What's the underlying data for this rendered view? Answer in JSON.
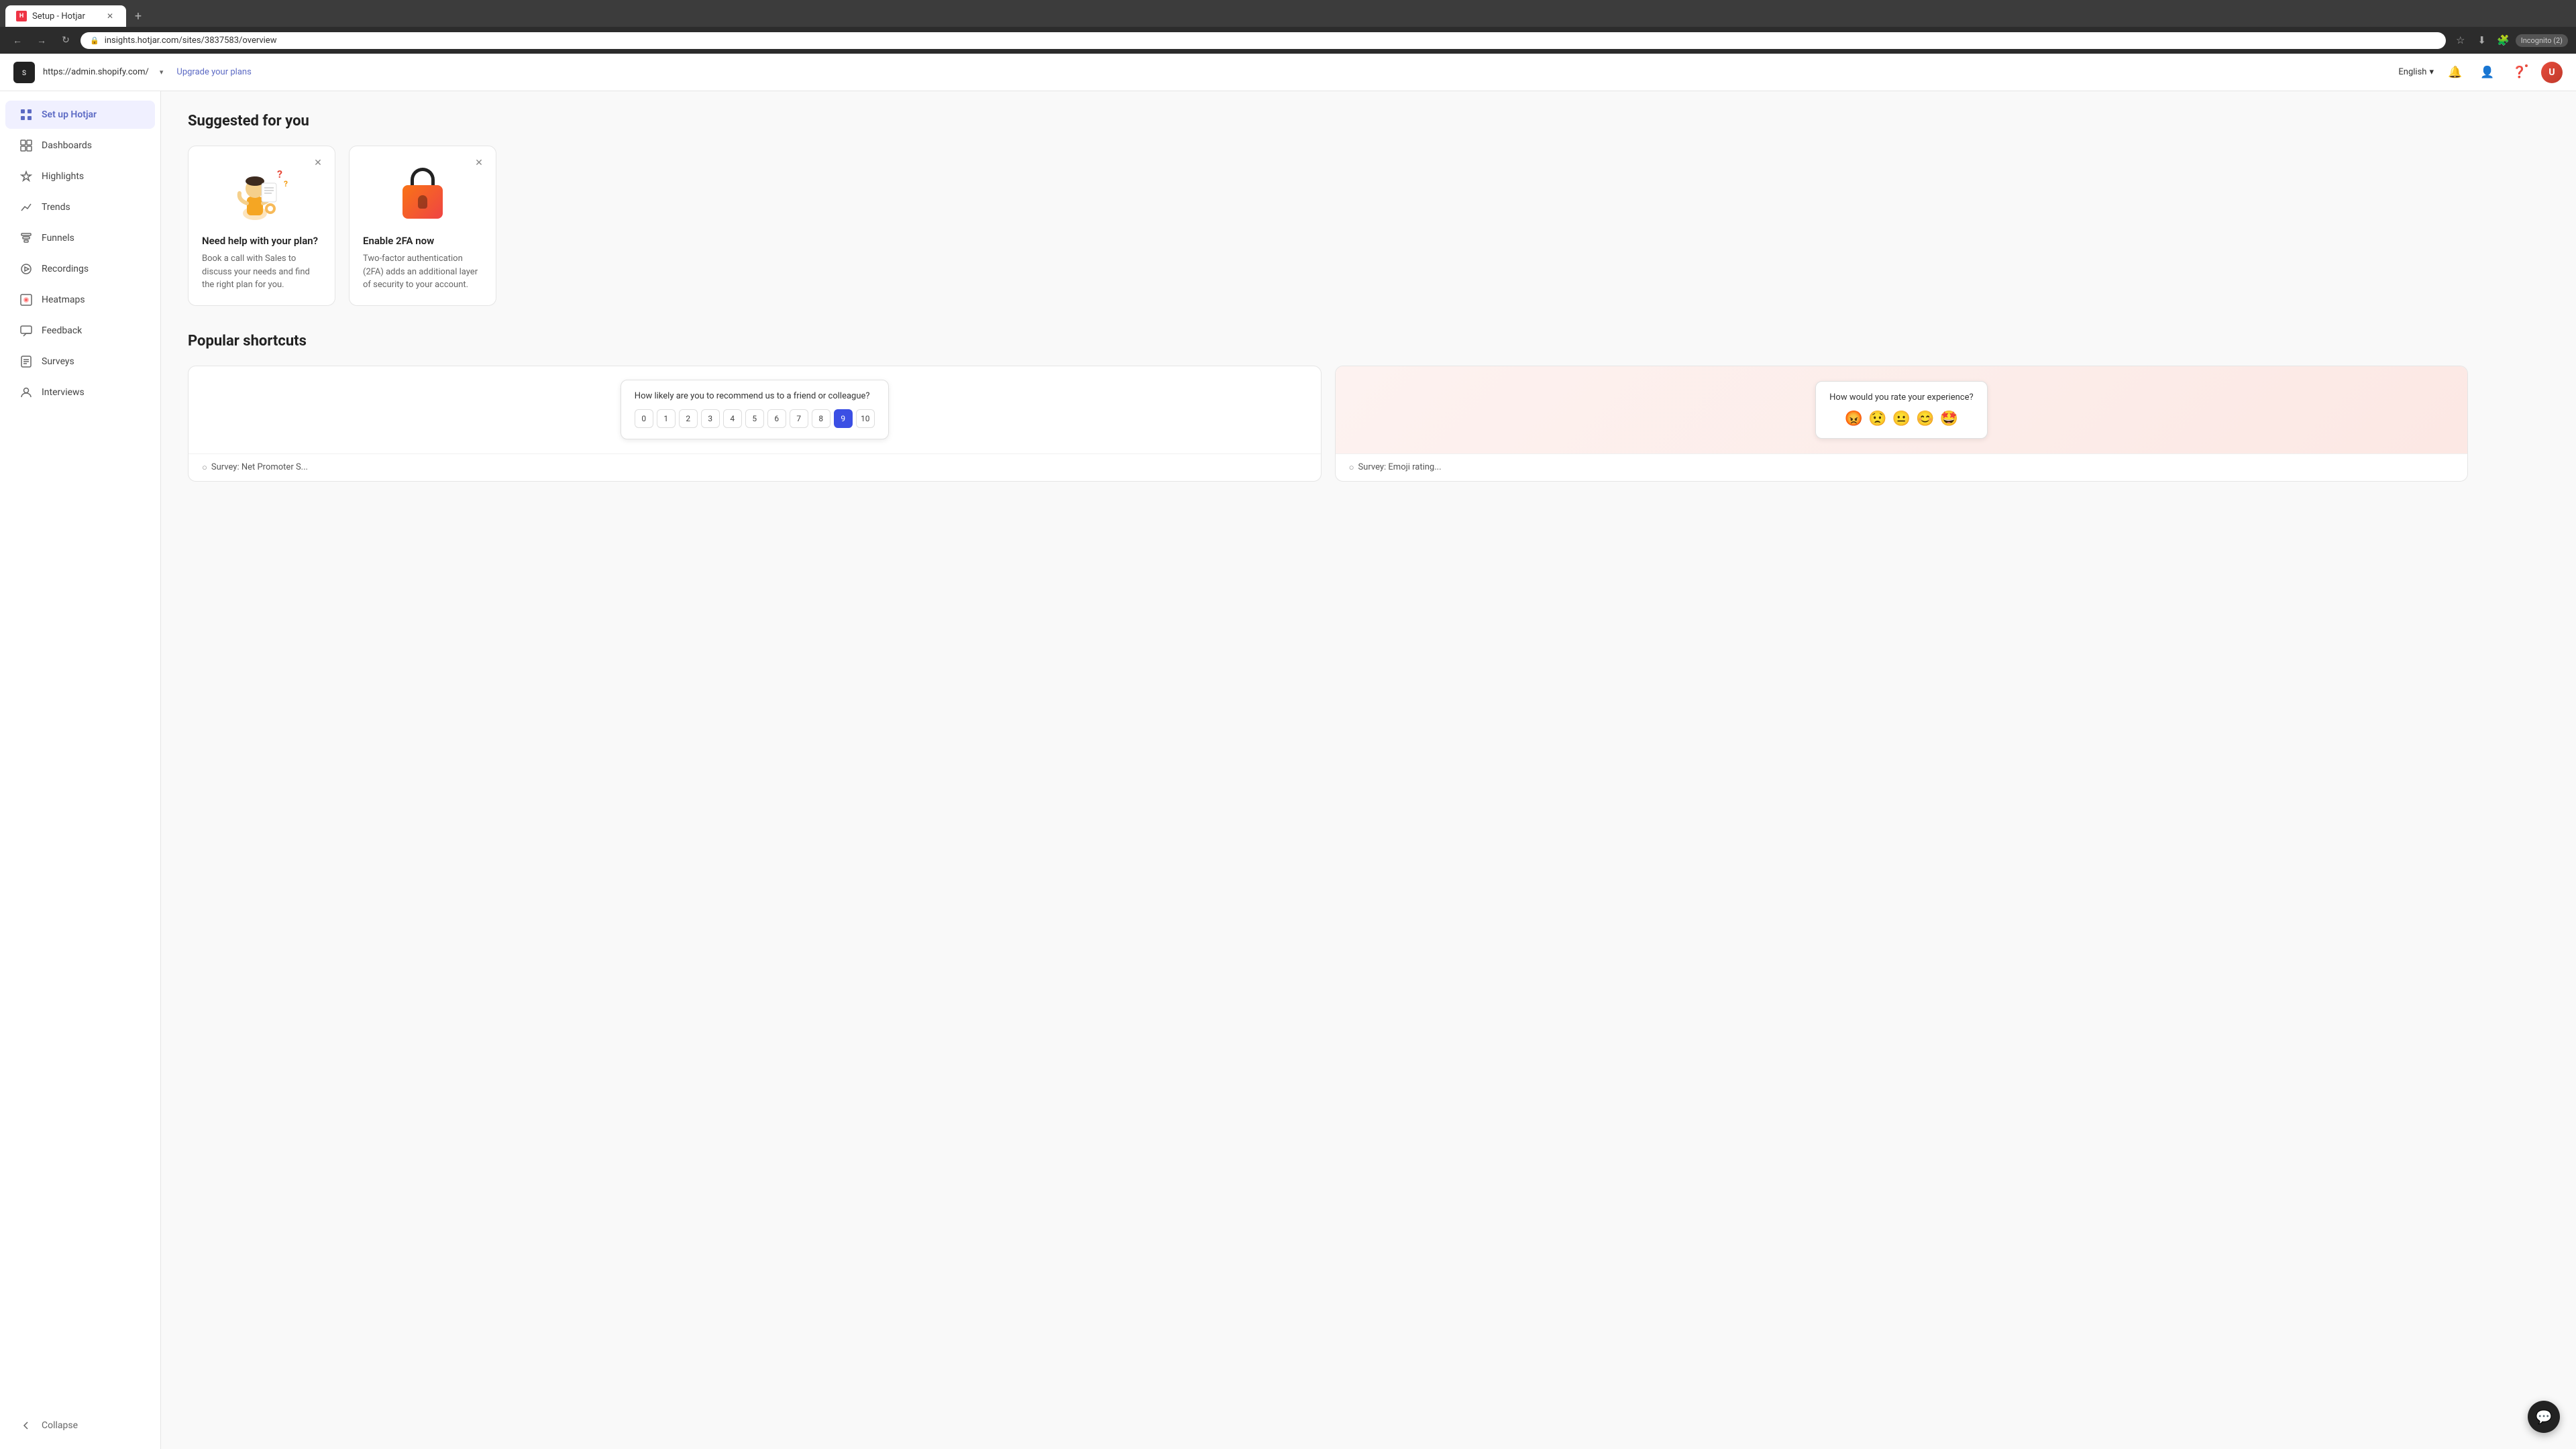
{
  "browser": {
    "tab_title": "Setup - Hotjar",
    "tab_favicon": "H",
    "address": "insights.hotjar.com/sites/3837583/overview",
    "incognito_label": "Incognito (2)",
    "new_tab_icon": "+"
  },
  "app_header": {
    "admin_url": "https://admin.shopify.com/",
    "upgrade_label": "Upgrade your plans",
    "language": "English",
    "language_chevron": "▾"
  },
  "sidebar": {
    "items": [
      {
        "id": "setup",
        "label": "Set up Hotjar",
        "active": true
      },
      {
        "id": "dashboards",
        "label": "Dashboards",
        "active": false
      },
      {
        "id": "highlights",
        "label": "Highlights",
        "active": false
      },
      {
        "id": "trends",
        "label": "Trends",
        "active": false
      },
      {
        "id": "funnels",
        "label": "Funnels",
        "active": false
      },
      {
        "id": "recordings",
        "label": "Recordings",
        "active": false
      },
      {
        "id": "heatmaps",
        "label": "Heatmaps",
        "active": false
      },
      {
        "id": "feedback",
        "label": "Feedback",
        "active": false
      },
      {
        "id": "surveys",
        "label": "Surveys",
        "active": false
      },
      {
        "id": "interviews",
        "label": "Interviews",
        "active": false
      }
    ],
    "collapse_label": "Collapse"
  },
  "content": {
    "suggested_title": "Suggested for you",
    "cards": [
      {
        "id": "help-plan",
        "title": "Need help with your plan?",
        "description": "Book a call with Sales to discuss your needs and find the right plan for you."
      },
      {
        "id": "enable-2fa",
        "title": "Enable 2FA now",
        "description": "Two-factor authentication (2FA) adds an additional layer of security to your account."
      }
    ],
    "shortcuts_title": "Popular shortcuts",
    "shortcuts": [
      {
        "id": "nps",
        "question": "How likely are you to recommend us to a friend or colleague?",
        "scale": [
          "0",
          "1",
          "2",
          "3",
          "4",
          "5",
          "6",
          "7",
          "8",
          "9",
          "10"
        ],
        "selected": "9",
        "label": "Survey: Net Promoter S...",
        "label_icon": "○"
      },
      {
        "id": "rating",
        "question": "How would you rate your experience?",
        "emojis": [
          "😡",
          "😟",
          "😐",
          "😊",
          "🤩"
        ],
        "label": "Survey: Emoji rating...",
        "label_icon": "○"
      }
    ]
  }
}
